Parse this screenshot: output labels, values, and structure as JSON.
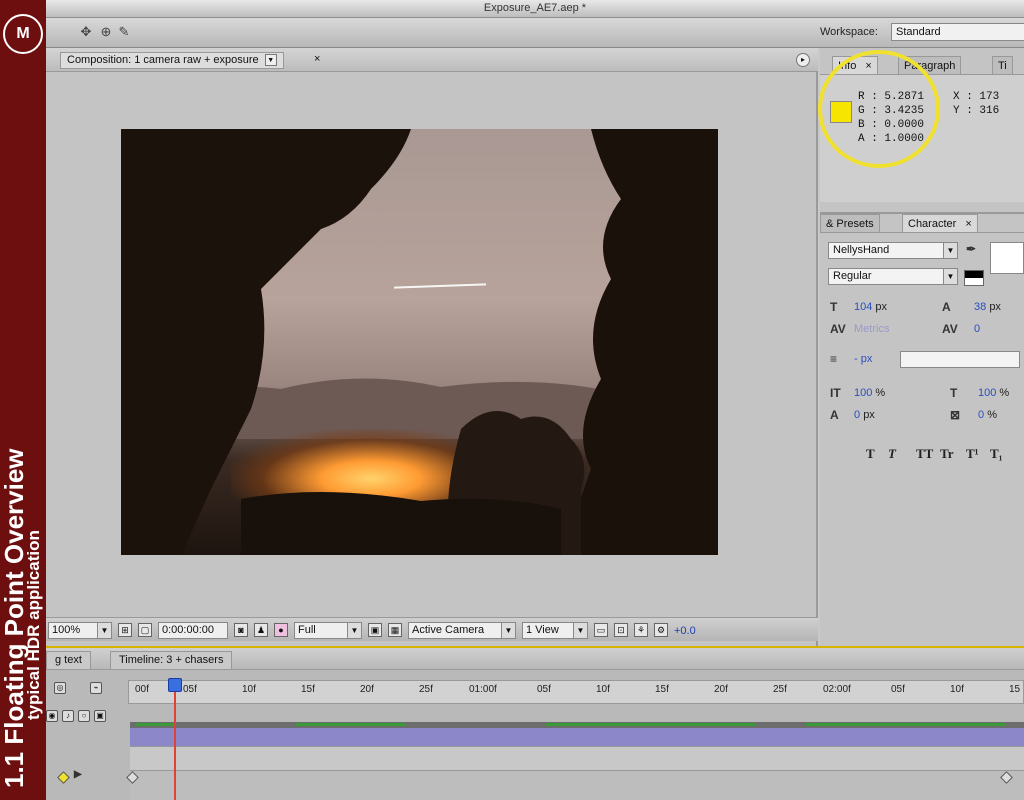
{
  "window": {
    "title": "Exposure_AE7.aep *"
  },
  "brand": {
    "logo": "M",
    "line1": "1.1  Floating Point Overview",
    "line2": "typical HDR application"
  },
  "workspace": {
    "label": "Workspace:",
    "value": "Standard"
  },
  "composition": {
    "tab_label": "Composition: 1 camera raw + exposure",
    "close": "×",
    "menu": "▸",
    "controls": {
      "zoom": "100%",
      "timecode": "0:00:00:00",
      "resolution": "Full",
      "camera": "Active Camera",
      "views": "1 View",
      "exposure": "+0.0"
    }
  },
  "info": {
    "tabs": [
      "Info",
      "Paragraph",
      "Ti"
    ],
    "close": "×",
    "swatch_color": "#f5e500",
    "values": [
      "R : 5.2871",
      "G : 3.4235",
      "B : 0.0000",
      "A : 1.0000"
    ],
    "coords": [
      "X : 173",
      "Y : 316"
    ]
  },
  "character": {
    "tabs": [
      "& Presets",
      "Character"
    ],
    "close": "×",
    "font": "NellysHand",
    "style": "Regular",
    "size": "104",
    "leading": "38",
    "kerning": "Metrics",
    "tracking": "0",
    "stroke_unit": "- px",
    "vscale": "100",
    "hscale": "100",
    "baseline": "0",
    "tsume": "0",
    "unit_px": "px",
    "unit_pct": "%",
    "format_buttons": [
      "T",
      "T",
      "TT",
      "Tr",
      "T¹",
      "T₁"
    ]
  },
  "timeline": {
    "tabs": [
      "g text",
      "Timeline: 3 + chasers"
    ],
    "ticks": [
      "00f",
      "05f",
      "10f",
      "15f",
      "20f",
      "25f",
      "01:00f",
      "05f",
      "10f",
      "15f",
      "20f",
      "25f",
      "02:00f",
      "05f",
      "10f",
      "15"
    ]
  },
  "colors": {
    "accent_yellow": "#f0e030",
    "bar_purple": "#8b87c9",
    "bar_green": "#3a9a3a",
    "playhead": "#d43"
  }
}
